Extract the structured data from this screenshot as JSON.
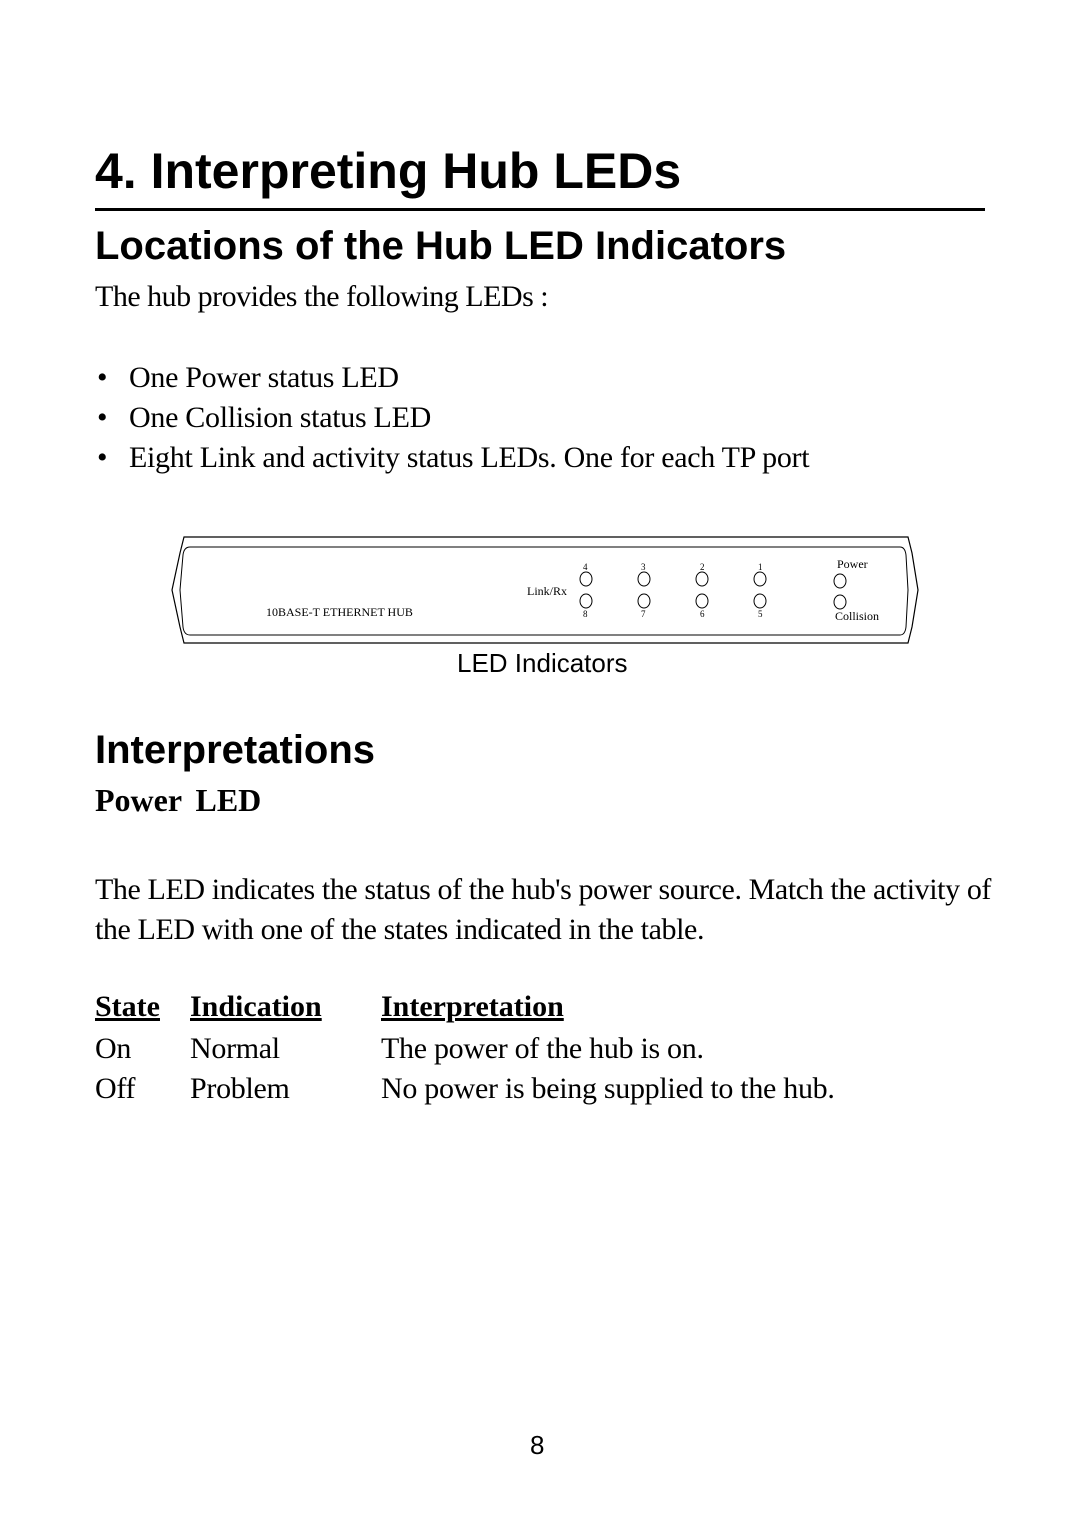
{
  "chapter_title": "4. Interpreting Hub LEDs",
  "section_locations": {
    "heading": "Locations of the Hub LED Indicators",
    "intro": "The hub provides the following LEDs :",
    "bullet_glyph": "•",
    "items": [
      "One Power status LED",
      "One Collision status LED",
      "Eight Link and activity status LEDs. One for each TP port"
    ]
  },
  "diagram": {
    "product_label": "10BASE-T ETHERNET HUB",
    "row_label": "Link/Rx",
    "top_ports": [
      "4",
      "3",
      "2",
      "1"
    ],
    "bottom_ports": [
      "8",
      "7",
      "6",
      "5"
    ],
    "power_label": "Power",
    "collision_label": "Collision",
    "caption": "LED Indicators"
  },
  "section_interpretations": {
    "heading": "Interpretations",
    "subheading": "Power LED",
    "paragraph": "The LED indicates the status of the hub's power source. Match the activity of the LED with one of the states indicated in the table.",
    "table": {
      "headers": [
        "State",
        "Indication",
        "Interpretation"
      ],
      "rows": [
        [
          "On",
          "Normal",
          "The power of the hub is on."
        ],
        [
          "Off",
          "Problem",
          "No power is being supplied to the hub."
        ]
      ]
    }
  },
  "page_number": "8"
}
